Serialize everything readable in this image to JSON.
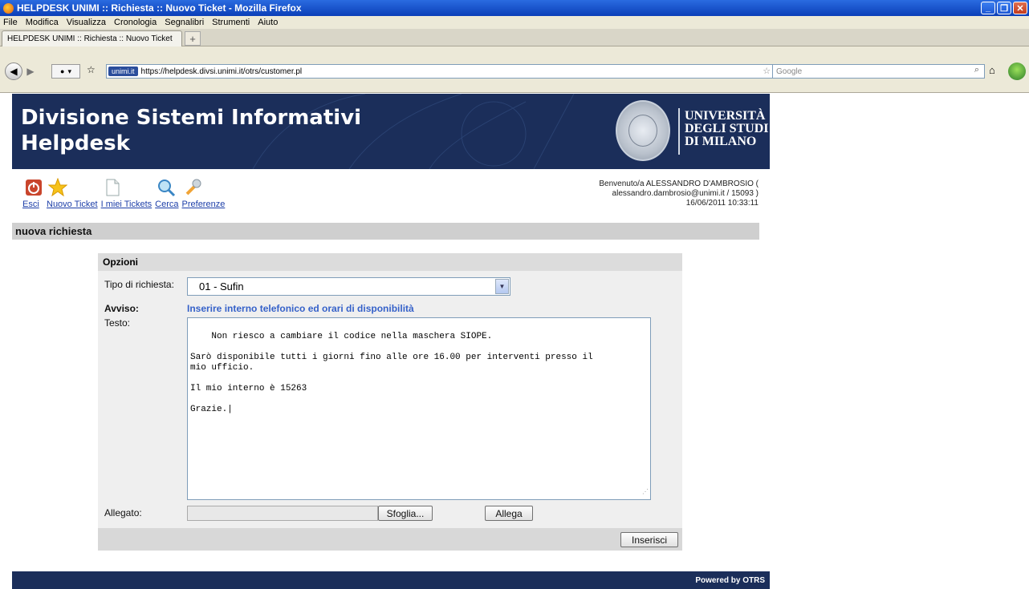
{
  "window": {
    "title": "HELPDESK UNIMI :: Richiesta :: Nuovo Ticket - Mozilla Firefox"
  },
  "menu": [
    "File",
    "Modifica",
    "Visualizza",
    "Cronologia",
    "Segnalibri",
    "Strumenti",
    "Aiuto"
  ],
  "tab": {
    "label": "HELPDESK UNIMI :: Richiesta :: Nuovo Ticket",
    "add": "+"
  },
  "urlbar": {
    "badge": "unimi.it",
    "url": "https://helpdesk.divsi.unimi.it/otrs/customer.pl"
  },
  "search": {
    "placeholder": "Google"
  },
  "banner": {
    "title_line1": "Divisione Sistemi Informativi",
    "title_line2": "Helpdesk",
    "uni_line1": "UNIVERSITÀ",
    "uni_line2": "DEGLI STUDI",
    "uni_line3": "DI MILANO"
  },
  "nav": {
    "items": [
      {
        "label": "Esci",
        "icon": "power-icon"
      },
      {
        "label": "Nuovo Ticket",
        "icon": "star-icon"
      },
      {
        "label": "I miei Tickets",
        "icon": "document-icon"
      },
      {
        "label": "Cerca",
        "icon": "magnifier-icon"
      },
      {
        "label": "Preferenze",
        "icon": "wrench-icon"
      }
    ]
  },
  "welcome": {
    "line1": "Benvenuto/a ALESSANDRO D'AMBROSIO (",
    "line2": "alessandro.dambrosio@unimi.it / 15093 )",
    "line3": "16/06/2011 10:33:11"
  },
  "section": {
    "title": "nuova richiesta"
  },
  "form": {
    "header": "Opzioni",
    "tipo_label": "Tipo di richiesta:",
    "tipo_value": "01 - Sufin",
    "avviso_label": "Avviso:",
    "avviso_text": "Inserire interno telefonico ed orari di disponibilità",
    "testo_label": "Testo:",
    "testo_value": "Non riesco a cambiare il codice nella maschera SIOPE.\n\nSarò disponibile tutti i giorni fino alle ore 16.00 per interventi presso il\nmio ufficio.\n\nIl mio interno è 15263\n\nGrazie.|",
    "allegato_label": "Allegato:",
    "sfoglia": "Sfoglia...",
    "allega": "Allega",
    "inserisci": "Inserisci"
  },
  "footer": {
    "text": "Powered by OTRS"
  }
}
